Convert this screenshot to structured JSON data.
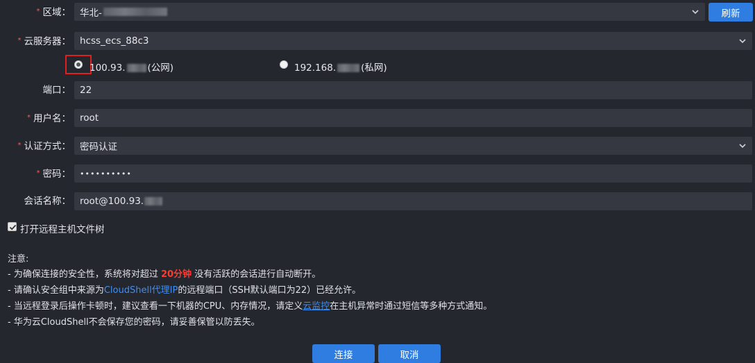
{
  "form": {
    "region": {
      "label": "区域：",
      "value": "华北-"
    },
    "refresh_label": "刷新",
    "server": {
      "label": "云服务器：",
      "value": "hcss_ecs_88c3"
    },
    "ip_options": [
      {
        "prefix": "100.93.",
        "suffix": "(公网)",
        "checked": true
      },
      {
        "prefix": "192.168.",
        "suffix": "(私网)",
        "checked": false
      }
    ],
    "port": {
      "label": "端口：",
      "value": "22"
    },
    "username": {
      "label": "用户名：",
      "value": "root"
    },
    "auth": {
      "label": "认证方式：",
      "value": "密码认证"
    },
    "password": {
      "label": "密码：",
      "value": "••••••••••"
    },
    "session": {
      "label": "会话名称：",
      "value": "root@100.93."
    },
    "file_tree_label": "打开远程主机文件树",
    "file_tree_checked": true
  },
  "notes": {
    "title": "注意:",
    "line1_a": "- 为确保连接的安全性，系统将对超过 ",
    "line1_highlight": "20分钟",
    "line1_b": " 没有活跃的会话进行自动断开。",
    "line2_a": "- 请确认安全组中来源为",
    "line2_link": "CloudShell代理IP",
    "line2_b": "的远程端口（SSH默认端口为22）已经允许。",
    "line3_a": "- 当远程登录后操作卡顿时，建议查看一下机器的CPU、内存情况，请定义",
    "line3_link": "云监控",
    "line3_b": "在主机异常时通过短信等多种方式通知。",
    "line4": "- 华为云CloudShell不会保存您的密码，请妥善保管以防丢失。"
  },
  "actions": {
    "connect_label": "连接",
    "cancel_label": "取消"
  },
  "colors": {
    "background": "#24272e",
    "field": "#353841",
    "accent": "#2f7de1",
    "required": "#ff5a5a",
    "highlight_red": "#ff3b30",
    "link": "#3f8ef0"
  }
}
